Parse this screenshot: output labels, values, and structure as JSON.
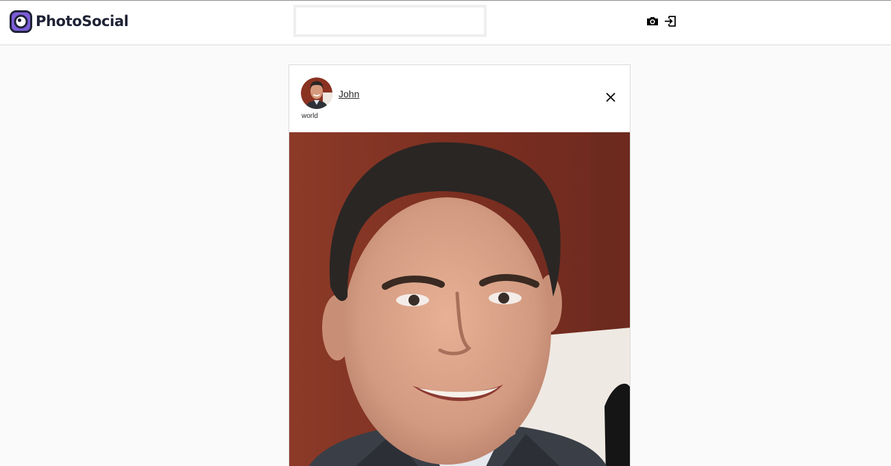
{
  "header": {
    "brand_name": "PhotoSocial",
    "search": {
      "value": "",
      "placeholder": ""
    },
    "icons": [
      "camera-icon",
      "logout-icon"
    ]
  },
  "post": {
    "username": "John",
    "location": "world",
    "avatar_icon": "user-avatar",
    "close_icon": "close-icon",
    "image": "portrait-photo"
  },
  "colors": {
    "page_background": "#fafafa",
    "header_background": "#ffffff",
    "logo_purple": "#7b5cd6",
    "logo_dark": "#1e2235",
    "photo_background": "#7a2e20"
  }
}
